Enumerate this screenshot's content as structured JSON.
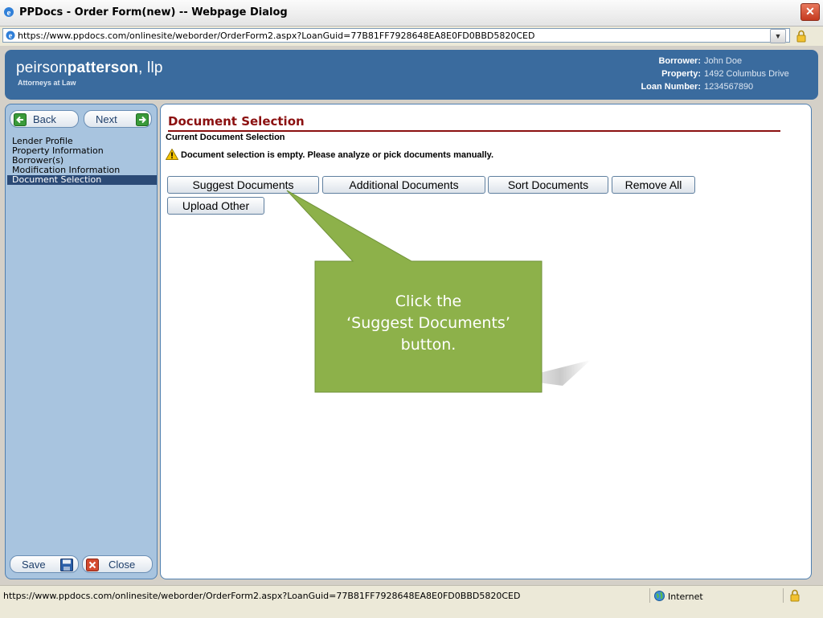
{
  "window": {
    "title": "PPDocs - Order Form(new) -- Webpage Dialog",
    "close_glyph": "✕",
    "url": "https://www.ppdocs.com/onlinesite/weborder/OrderForm2.aspx?LoanGuid=77B81FF7928648EA8E0FD0BBD5820CED"
  },
  "header": {
    "brand_light": "peirson",
    "brand_bold": "patterson",
    "brand_tail": ", llp",
    "tagline": "Attorneys at Law",
    "borrower_label": "Borrower:",
    "borrower_value": "John Doe",
    "property_label": "Property:",
    "property_value": "1492 Columbus Drive",
    "loan_label": "Loan Number:",
    "loan_value": "1234567890"
  },
  "sidebar": {
    "back_label": "Back",
    "next_label": "Next",
    "items": [
      {
        "label": "Lender Profile"
      },
      {
        "label": "Property Information"
      },
      {
        "label": "Borrower(s)"
      },
      {
        "label": "Modification Information"
      },
      {
        "label": "Document Selection"
      }
    ],
    "active_index": 4,
    "save_label": "Save",
    "close_label": "Close"
  },
  "main": {
    "section_title": "Document Selection",
    "subheading": "Current Document Selection",
    "warning": "Document selection is empty. Please analyze or pick documents manually.",
    "buttons": {
      "suggest": "Suggest Documents",
      "additional": "Additional Documents",
      "sort": "Sort Documents",
      "remove_all": "Remove All",
      "upload": "Upload Other"
    }
  },
  "callout": {
    "line1": "Click the",
    "line2": "‘Suggest Documents’",
    "line3": "button."
  },
  "statusbar": {
    "url": "https://www.ppdocs.com/onlinesite/weborder/OrderForm2.aspx?LoanGuid=77B81FF7928648EA8E0FD0BBD5820CED",
    "zone": "Internet"
  },
  "colors": {
    "header_blue": "#3a6b9e",
    "sidebar_blue": "#a8c4df",
    "section_red": "#8b1010",
    "callout_green": "#8db14a"
  }
}
